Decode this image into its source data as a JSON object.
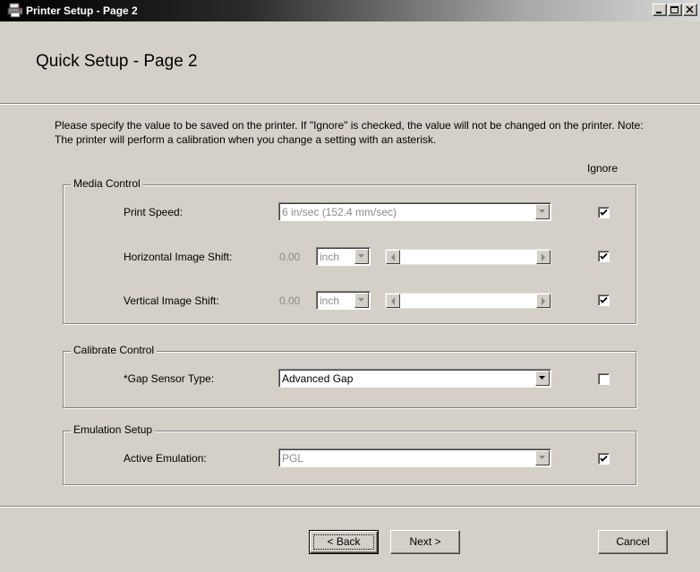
{
  "window": {
    "title": "Printer Setup - Page 2"
  },
  "header": {
    "heading": "Quick Setup - Page 2"
  },
  "instructions": "Please specify the value to be saved on the printer. If \"Ignore\" is checked, the value will not be changed on the printer. Note: The printer will perform a calibration when you change a setting with an asterisk.",
  "ignore_label": "Ignore",
  "media_control": {
    "legend": "Media Control",
    "print_speed": {
      "label": "Print Speed:",
      "value": "6 in/sec (152.4 mm/sec)",
      "ignore": true
    },
    "horizontal_shift": {
      "label": "Horizontal Image Shift:",
      "value": "0.00",
      "unit": "inch",
      "ignore": true
    },
    "vertical_shift": {
      "label": "Vertical Image Shift:",
      "value": "0.00",
      "unit": "inch",
      "ignore": true
    }
  },
  "calibrate_control": {
    "legend": "Calibrate Control",
    "gap_sensor": {
      "label": "*Gap Sensor Type:",
      "value": "Advanced Gap",
      "ignore": false
    }
  },
  "emulation_setup": {
    "legend": "Emulation Setup",
    "active_emulation": {
      "label": "Active Emulation:",
      "value": "PGL",
      "ignore": true
    }
  },
  "buttons": {
    "back": "< Back",
    "next": "Next >",
    "cancel": "Cancel"
  }
}
